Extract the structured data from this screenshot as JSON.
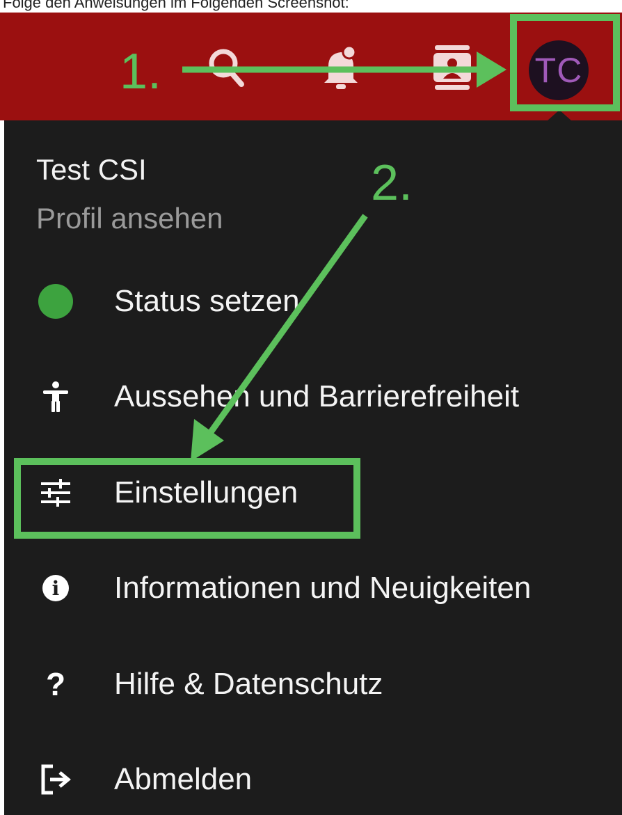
{
  "top_strip": {
    "text": "Folge den Anweisungen im Folgenden Screenshot:"
  },
  "header": {
    "background": "#9b1010",
    "icons": [
      "search-icon",
      "notification-bell-icon",
      "contact-card-icon"
    ],
    "avatar_initials": "TC"
  },
  "profile": {
    "name": "Test CSI",
    "link_label": "Profil ansehen"
  },
  "menu": {
    "items": [
      {
        "label": "Status setzen",
        "icon": "status-dot-icon",
        "status_color": "#3da33f"
      },
      {
        "label": "Aussehen und Barrierefreiheit",
        "icon": "accessibility-icon"
      },
      {
        "label": "Einstellungen",
        "icon": "settings-sliders-icon"
      },
      {
        "label": "Informationen und Neuigkeiten",
        "icon": "info-icon"
      },
      {
        "label": "Hilfe & Datenschutz",
        "icon": "help-icon"
      },
      {
        "label": "Abmelden",
        "icon": "logout-icon"
      }
    ]
  },
  "annotations": {
    "color": "#5cc05c",
    "step1_label": "1.",
    "step2_label": "2."
  }
}
